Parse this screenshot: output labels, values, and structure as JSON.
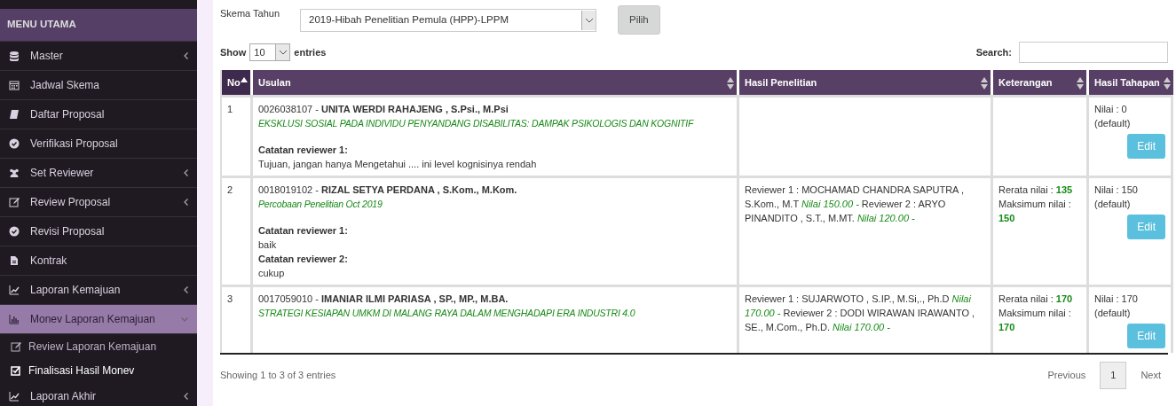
{
  "sidebar": {
    "title": "MENU UTAMA",
    "items": [
      {
        "label": "Master",
        "kind": "submenu",
        "expanded": false,
        "selected": false
      },
      {
        "label": "Jadwal Skema",
        "kind": "link",
        "selected": false
      },
      {
        "label": "Daftar Proposal",
        "kind": "link",
        "selected": false
      },
      {
        "label": "Verifikasi Proposal",
        "kind": "link",
        "selected": false
      },
      {
        "label": "Set Reviewer",
        "kind": "submenu",
        "expanded": false,
        "selected": false
      },
      {
        "label": "Review Proposal",
        "kind": "submenu",
        "expanded": false,
        "selected": false
      },
      {
        "label": "Revisi Proposal",
        "kind": "link",
        "selected": false
      },
      {
        "label": "Kontrak",
        "kind": "link",
        "selected": false
      },
      {
        "label": "Laporan Kemajuan",
        "kind": "submenu",
        "expanded": false,
        "selected": false
      },
      {
        "label": "Monev Laporan Kemajuan",
        "kind": "submenu",
        "expanded": true,
        "selected": true,
        "children": [
          {
            "label": "Review Laporan Kemajuan",
            "selected": false
          },
          {
            "label": "Finalisasi Hasil Monev",
            "selected": true
          }
        ]
      },
      {
        "label": "Laporan Akhir",
        "kind": "submenu",
        "expanded": false,
        "selected": false
      }
    ]
  },
  "filter": {
    "label": "Skema Tahun",
    "value": "2019-Hibah Penelitian Pemula (HPP)-LPPM",
    "button": "Pilih"
  },
  "length": {
    "before": "Show",
    "value": "10",
    "after": "entries"
  },
  "search": {
    "label": "Search:"
  },
  "table": {
    "columns": [
      {
        "label": "No",
        "sorted": true
      },
      {
        "label": "Usulan",
        "sorted": false
      },
      {
        "label": "Hasil Penelitian",
        "sorted": false
      },
      {
        "label": "Keterangan",
        "sorted": false
      },
      {
        "label": "Hasil Tahapan",
        "sorted": false
      }
    ],
    "rows": [
      {
        "no": "1",
        "proposer": "0026038107 - **UNITA WERDI RAHAJENG , S.Psi., M.Psi**",
        "title": "EKSKLUSI SOSIAL PADA INDIVIDU PENYANDANG DISABILITAS: DAMPAK PSIKOLOGIS DAN KOGNITIF",
        "notes": [
          {
            "label": "Catatan reviewer 1:",
            "text": "Tujuan, jangan hanya Mengetahui .... ini level kognisinya rendah"
          }
        ],
        "result": "Nilai : 0 (default)",
        "button": "Edit"
      },
      {
        "no": "2",
        "proposer": "0018019102 - **RIZAL SETYA PERDANA , S.Kom., M.Kom.**",
        "title": "Percobaan Penelitian Oct 2019",
        "notes": [
          {
            "label": "Catatan reviewer 1:",
            "text": "baik"
          },
          {
            "label": "Catatan reviewer 2:",
            "text": "cukup"
          }
        ],
        "research": "Reviewer 1 : MOCHAMAD CHANDRA SAPUTRA , S.Kom., M.T *Nilai 150.00 -* Reviewer 2 : ARYO PINANDITO , S.T., M.MT. *Nilai 120.00 -*",
        "average": "Rerata nilai : **135**",
        "maximum": "Maksimum nilai : **150**",
        "result": "Nilai : 150 (default)",
        "button": "Edit"
      },
      {
        "no": "3",
        "proposer": "0017059010 - **IMANIAR ILMI PARIASA , SP., MP., M.BA.**",
        "title": "STRATEGI KESIAPAN UMKM DI MALANG RAYA DALAM MENGHADAPI ERA INDUSTRI 4.0",
        "notes": [],
        "research": "Reviewer 1 : SUJARWOTO , S.IP., M.Si,., Ph.D *Nilai 170.00 -* Reviewer 2 : DODI WIRAWAN IRAWANTO , SE., M.Com., Ph.D. *Nilai 170.00 -*",
        "average": "Rerata nilai : **170**",
        "maximum": "Maksimum nilai : **170**",
        "result": "Nilai : 170 (default)",
        "button": "Edit"
      }
    ]
  },
  "info": "Showing 1 to 3 of 3 entries",
  "pagination": {
    "previous": "Previous",
    "pages": [
      {
        "label": "1",
        "selected": true
      }
    ],
    "next": "Next"
  }
}
